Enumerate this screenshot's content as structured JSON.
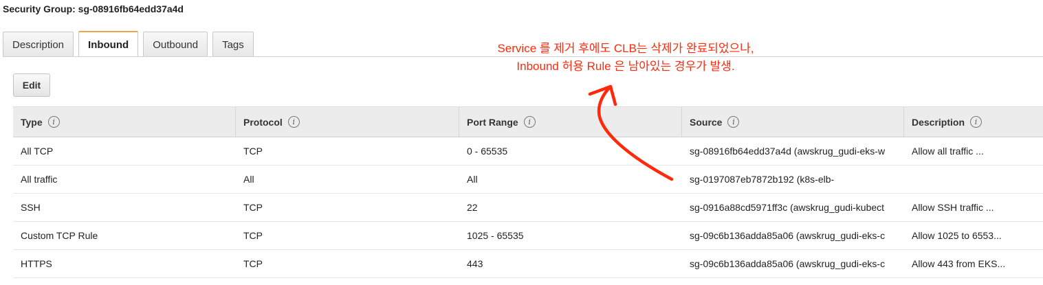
{
  "header": {
    "title": "Security Group: sg-08916fb64edd37a4d"
  },
  "tabs": [
    {
      "label": "Description",
      "active": false
    },
    {
      "label": "Inbound",
      "active": true
    },
    {
      "label": "Outbound",
      "active": false
    },
    {
      "label": "Tags",
      "active": false
    }
  ],
  "toolbar": {
    "edit_label": "Edit"
  },
  "table": {
    "columns": [
      "Type",
      "Protocol",
      "Port Range",
      "Source",
      "Description"
    ],
    "info_glyph": "i",
    "rows": [
      [
        "All TCP",
        "TCP",
        "0 - 65535",
        "sg-08916fb64edd37a4d (awskrug_gudi-eks-w",
        "Allow all traffic ..."
      ],
      [
        "All traffic",
        "All",
        "All",
        "sg-0197087eb7872b192 (k8s-elb-",
        ""
      ],
      [
        "SSH",
        "TCP",
        "22",
        "sg-0916a88cd5971ff3c (awskrug_gudi-kubect",
        "Allow SSH traffic ..."
      ],
      [
        "Custom TCP Rule",
        "TCP",
        "1025 - 65535",
        "sg-09c6b136adda85a06 (awskrug_gudi-eks-c",
        "Allow 1025 to 6553..."
      ],
      [
        "HTTPS",
        "TCP",
        "443",
        "sg-09c6b136adda85a06 (awskrug_gudi-eks-c",
        "Allow 443 from EKS..."
      ]
    ]
  },
  "annotation": {
    "line1": "Service 를 제거 후에도 CLB는 삭제가 완료되었으나,",
    "line2": "Inbound 허용 Rule 은 남아있는 경우가 발생.",
    "color": "#ff2a0c"
  },
  "colors": {
    "active_tab_accent": "#f0a442",
    "header_bg": "#ececec"
  }
}
